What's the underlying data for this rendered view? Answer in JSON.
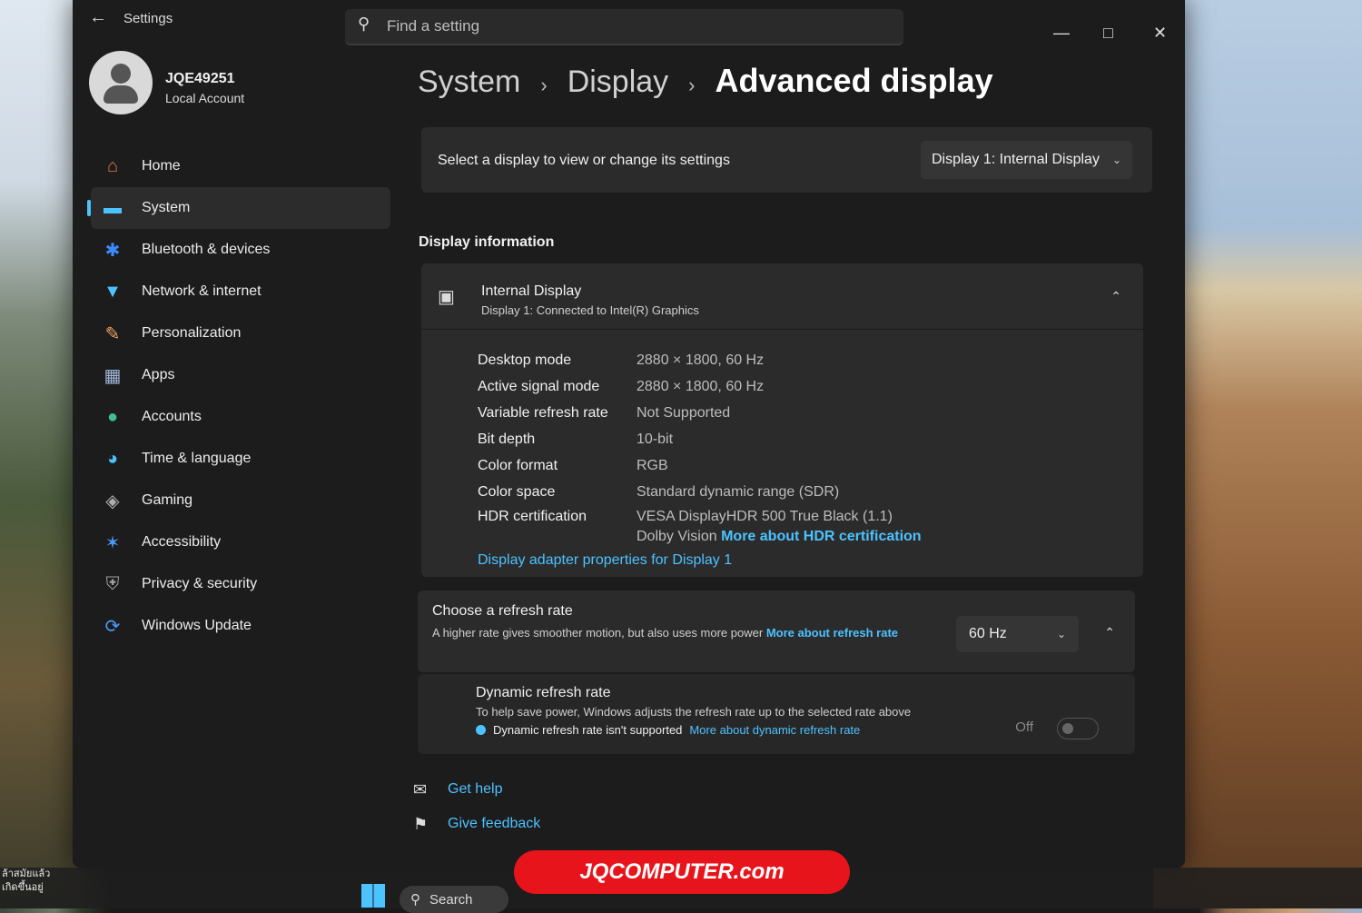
{
  "app": {
    "title": "Settings"
  },
  "search": {
    "placeholder": "Find a setting"
  },
  "user": {
    "name": "JQE49251",
    "account_type": "Local Account"
  },
  "nav": {
    "items": [
      {
        "label": "Home",
        "icon": "home-icon"
      },
      {
        "label": "System",
        "icon": "monitor-icon",
        "active": true
      },
      {
        "label": "Bluetooth & devices",
        "icon": "bluetooth-icon"
      },
      {
        "label": "Network & internet",
        "icon": "wifi-icon"
      },
      {
        "label": "Personalization",
        "icon": "brush-icon"
      },
      {
        "label": "Apps",
        "icon": "apps-icon"
      },
      {
        "label": "Accounts",
        "icon": "person-icon"
      },
      {
        "label": "Time & language",
        "icon": "clock-globe-icon"
      },
      {
        "label": "Gaming",
        "icon": "controller-icon"
      },
      {
        "label": "Accessibility",
        "icon": "accessibility-icon"
      },
      {
        "label": "Privacy & security",
        "icon": "shield-icon"
      },
      {
        "label": "Windows Update",
        "icon": "update-icon"
      }
    ]
  },
  "breadcrumb": {
    "items": [
      "System",
      "Display"
    ],
    "current": "Advanced display"
  },
  "display_select": {
    "label": "Select a display to view or change its settings",
    "value": "Display 1: Internal Display"
  },
  "display_info": {
    "section_title": "Display information",
    "name": "Internal Display",
    "subtitle": "Display 1: Connected to Intel(R) Graphics",
    "rows": [
      {
        "label": "Desktop mode",
        "value": "2880 × 1800, 60 Hz"
      },
      {
        "label": "Active signal mode",
        "value": "2880 × 1800, 60 Hz"
      },
      {
        "label": "Variable refresh rate",
        "value": "Not Supported"
      },
      {
        "label": "Bit depth",
        "value": "10-bit"
      },
      {
        "label": "Color format",
        "value": "RGB"
      },
      {
        "label": "Color space",
        "value": "Standard dynamic range (SDR)"
      }
    ],
    "hdr": {
      "label": "HDR certification",
      "line1": "VESA DisplayHDR 500 True Black (1.1)",
      "line2": "Dolby Vision",
      "link": "More about HDR certification"
    },
    "adapter_link": "Display adapter properties for Display 1"
  },
  "refresh": {
    "title": "Choose a refresh rate",
    "description": "A higher rate gives smoother motion, but also uses more power",
    "link": "More about refresh rate",
    "value": "60 Hz"
  },
  "dynamic_refresh": {
    "title": "Dynamic refresh rate",
    "description": "To help save power, Windows adjusts the refresh rate up to the selected rate above",
    "note": "Dynamic refresh rate isn't supported",
    "link": "More about dynamic refresh rate",
    "toggle_state": "Off"
  },
  "help": {
    "get_help": "Get help",
    "give_feedback": "Give feedback"
  },
  "taskbar": {
    "search": "Search"
  },
  "watermark": "JQCOMPUTER.com",
  "side_note": {
    "line1": "ล้าสมัยแล้ว",
    "line2": "เกิดขึ้นอยู่"
  },
  "colors": {
    "accent": "#4cc2ff",
    "window_bg": "#1c1c1c",
    "card_bg": "#2b2b2b",
    "banner": "#e8141b"
  }
}
